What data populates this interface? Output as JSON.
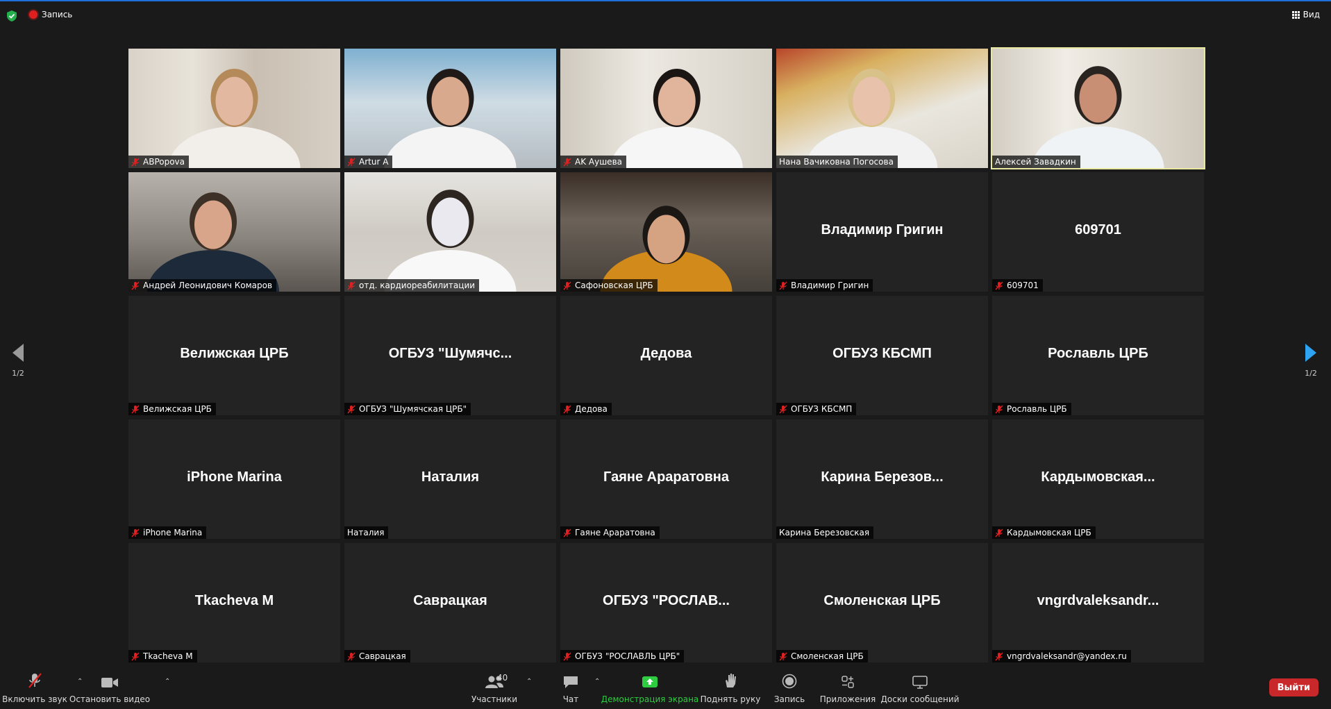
{
  "topbar": {
    "recording_label": "Запись",
    "view_label": "Вид"
  },
  "colors": {
    "accent_blue": "#2ea3f2",
    "mic_off_red": "#e02020",
    "leave_red": "#c8282a",
    "active_speaker": "#e8e8a0",
    "share_green": "#2ecc40"
  },
  "tiles": [
    {
      "type": "video",
      "label": "ABPopova",
      "muted": true
    },
    {
      "type": "video",
      "label": "Artur A",
      "muted": true
    },
    {
      "type": "video",
      "label": "AK Аушева",
      "muted": true
    },
    {
      "type": "video",
      "label": "Нана Вачиковна Погосова",
      "muted": false
    },
    {
      "type": "video",
      "label": "Алексей Завадкин",
      "muted": false,
      "active": true
    },
    {
      "type": "video",
      "label": "Андрей Леонидович Комаров",
      "muted": true
    },
    {
      "type": "video",
      "label": "отд. кардиореабилитации",
      "muted": true
    },
    {
      "type": "video",
      "label": "Сафоновская ЦРБ",
      "muted": true
    },
    {
      "type": "name",
      "center": "Владимир Григин",
      "label": "Владимир Григин",
      "muted": true
    },
    {
      "type": "name",
      "center": "609701",
      "label": "609701",
      "muted": true
    },
    {
      "type": "name",
      "center": "Велижская ЦРБ",
      "label": "Велижская ЦРБ",
      "muted": true
    },
    {
      "type": "name",
      "center": "ОГБУЗ  \"Шумячс...",
      "label": "ОГБУЗ \"Шумячская ЦРБ\"",
      "muted": true
    },
    {
      "type": "name",
      "center": "Дедова",
      "label": "Дедова",
      "muted": true
    },
    {
      "type": "name",
      "center": "ОГБУЗ КБСМП",
      "label": "ОГБУЗ КБСМП",
      "muted": true
    },
    {
      "type": "name",
      "center": "Рославль ЦРБ",
      "label": "Рославль ЦРБ",
      "muted": true
    },
    {
      "type": "name",
      "center": "iPhone Marina",
      "label": "iPhone Marina",
      "muted": true
    },
    {
      "type": "name",
      "center": "Наталия",
      "label": "Наталия",
      "muted": false
    },
    {
      "type": "name",
      "center": "Гаяне Араратовна",
      "label": "Гаяне Араратовна",
      "muted": true
    },
    {
      "type": "name",
      "center": "Карина  Березов...",
      "label": "Карина Березовская",
      "muted": false
    },
    {
      "type": "name",
      "center": "Кардымовская...",
      "label": "Кардымовская ЦРБ",
      "muted": true
    },
    {
      "type": "name",
      "center": "Tkacheva M",
      "label": "Tkacheva M",
      "muted": true
    },
    {
      "type": "name",
      "center": "Саврацкая",
      "label": "Саврацкая",
      "muted": true
    },
    {
      "type": "name",
      "center": "ОГБУЗ  \"РОСЛАВ...",
      "label": "ОГБУЗ \"РОСЛАВЛЬ ЦРБ\"",
      "muted": true
    },
    {
      "type": "name",
      "center": "Смоленская ЦРБ",
      "label": "Смоленская ЦРБ",
      "muted": true
    },
    {
      "type": "name",
      "center": "vngrdvaleksandr...",
      "label": "vngrdvaleksandr@yandex.ru",
      "muted": true
    }
  ],
  "pager": {
    "left": "1/2",
    "right": "1/2"
  },
  "toolbar": {
    "unmute": "Включить звук",
    "stop_video": "Остановить видео",
    "participants": "Участники",
    "participants_count": "40",
    "chat": "Чат",
    "share_screen": "Демонстрация экрана",
    "raise_hand": "Поднять руку",
    "record": "Запись",
    "apps": "Приложения",
    "whiteboards": "Доски сообщений",
    "leave": "Выйти"
  }
}
